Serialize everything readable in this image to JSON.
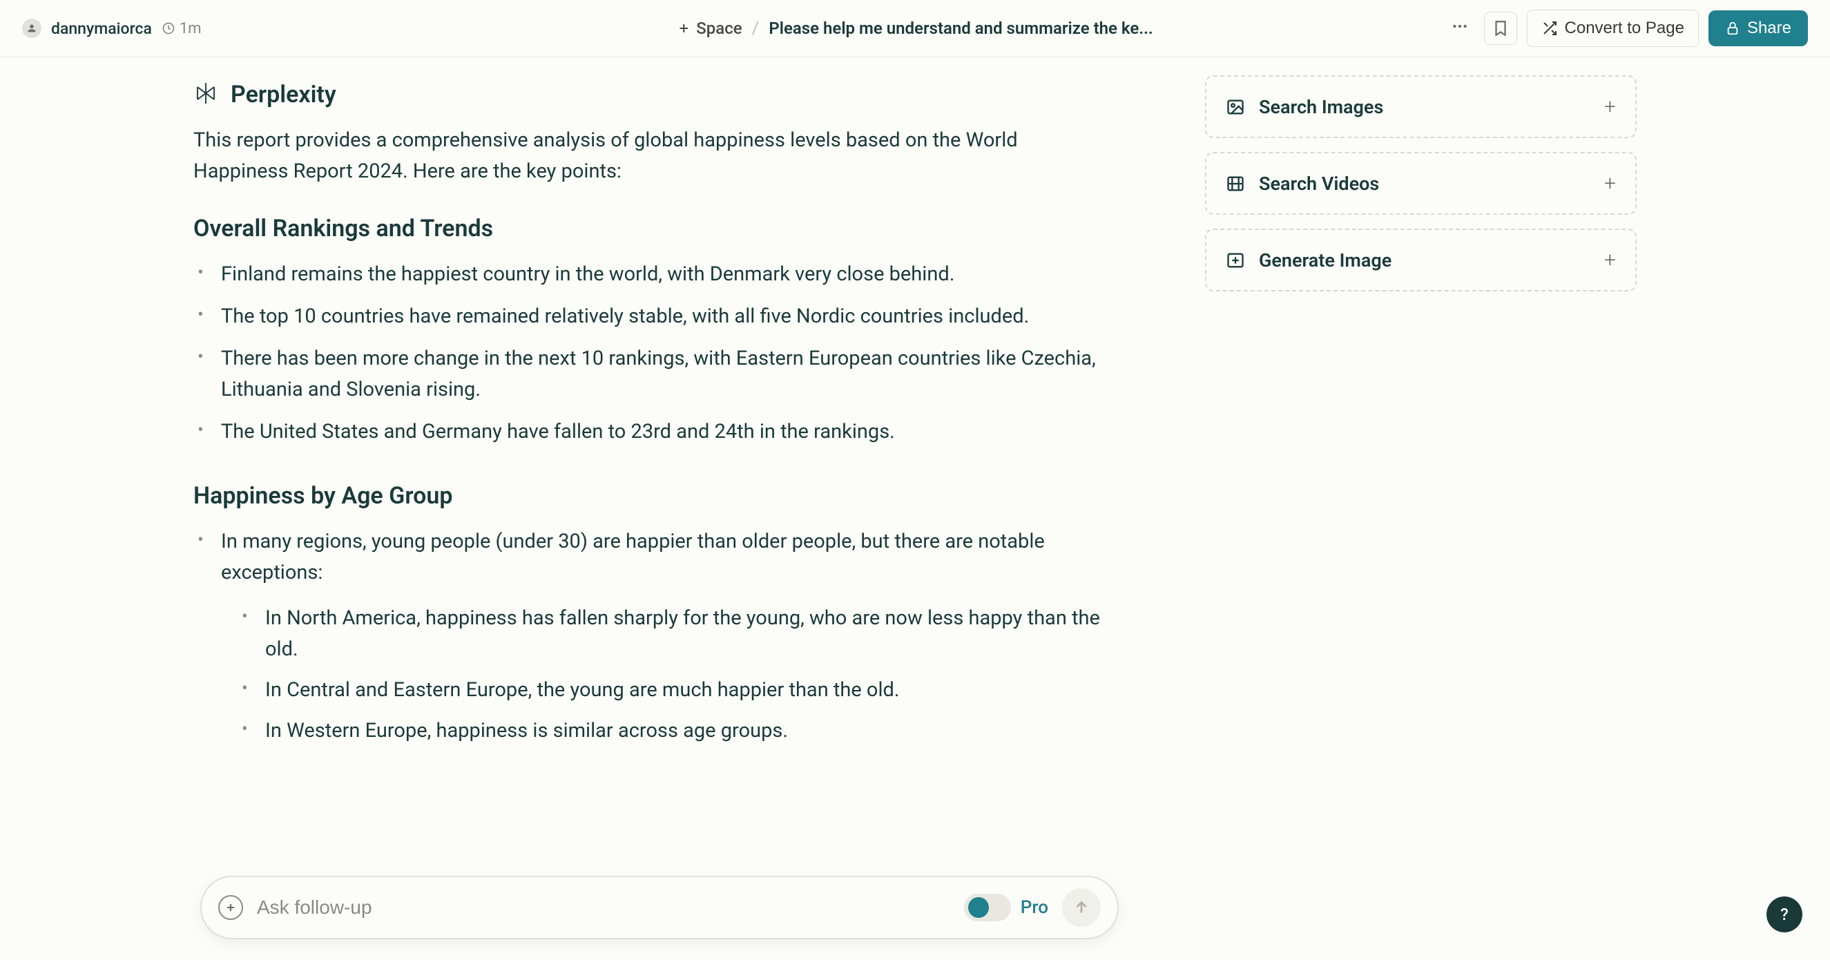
{
  "header": {
    "username": "dannymaiorca",
    "timestamp": "1m",
    "space_label": "Space",
    "page_title": "Please help me understand and summarize the ke...",
    "convert_label": "Convert to Page",
    "share_label": "Share"
  },
  "article": {
    "brand": "Perplexity",
    "intro": "This report provides a comprehensive analysis of global happiness levels based on the World Happiness Report 2024. Here are the key points:",
    "sections": [
      {
        "heading": "Overall Rankings and Trends",
        "items": [
          "Finland remains the happiest country in the world, with Denmark very close behind.",
          "The top 10 countries have remained relatively stable, with all five Nordic countries included.",
          "There has been more change in the next 10 rankings, with Eastern European countries like Czechia, Lithuania and Slovenia rising.",
          "The United States and Germany have fallen to 23rd and 24th in the rankings."
        ]
      },
      {
        "heading": "Happiness by Age Group",
        "items": [
          "In many regions, young people (under 30) are happier than older people, but there are notable exceptions:"
        ],
        "nested": [
          "In North America, happiness has fallen sharply for the young, who are now less happy than the old.",
          "In Central and Eastern Europe, the young are much happier than the old.",
          "In Western Europe, happiness is similar across age groups."
        ]
      }
    ]
  },
  "sidebar": {
    "cards": [
      {
        "label": "Search Images"
      },
      {
        "label": "Search Videos"
      },
      {
        "label": "Generate Image"
      }
    ]
  },
  "input": {
    "placeholder": "Ask follow-up",
    "pro_label": "Pro"
  },
  "help": "?"
}
